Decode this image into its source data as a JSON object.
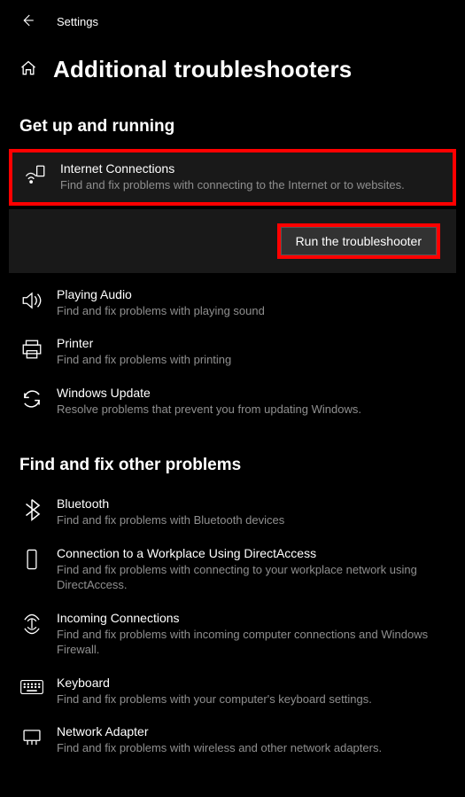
{
  "header": {
    "app_title": "Settings",
    "page_title": "Additional troubleshooters"
  },
  "run_button_label": "Run the troubleshooter",
  "sections": [
    {
      "title": "Get up and running",
      "items": [
        {
          "icon": "internet-icon",
          "name": "Internet Connections",
          "desc": "Find and fix problems with connecting to the Internet or to websites.",
          "selected": true
        },
        {
          "icon": "audio-icon",
          "name": "Playing Audio",
          "desc": "Find and fix problems with playing sound"
        },
        {
          "icon": "printer-icon",
          "name": "Printer",
          "desc": "Find and fix problems with printing"
        },
        {
          "icon": "update-icon",
          "name": "Windows Update",
          "desc": "Resolve problems that prevent you from updating Windows."
        }
      ]
    },
    {
      "title": "Find and fix other problems",
      "items": [
        {
          "icon": "bluetooth-icon",
          "name": "Bluetooth",
          "desc": "Find and fix problems with Bluetooth devices"
        },
        {
          "icon": "workplace-icon",
          "name": "Connection to a Workplace Using DirectAccess",
          "desc": "Find and fix problems with connecting to your workplace network using DirectAccess."
        },
        {
          "icon": "incoming-icon",
          "name": "Incoming Connections",
          "desc": "Find and fix problems with incoming computer connections and Windows Firewall."
        },
        {
          "icon": "keyboard-icon",
          "name": "Keyboard",
          "desc": "Find and fix problems with your computer's keyboard settings."
        },
        {
          "icon": "network-adapter-icon",
          "name": "Network Adapter",
          "desc": "Find and fix problems with wireless and other network adapters."
        }
      ]
    }
  ]
}
